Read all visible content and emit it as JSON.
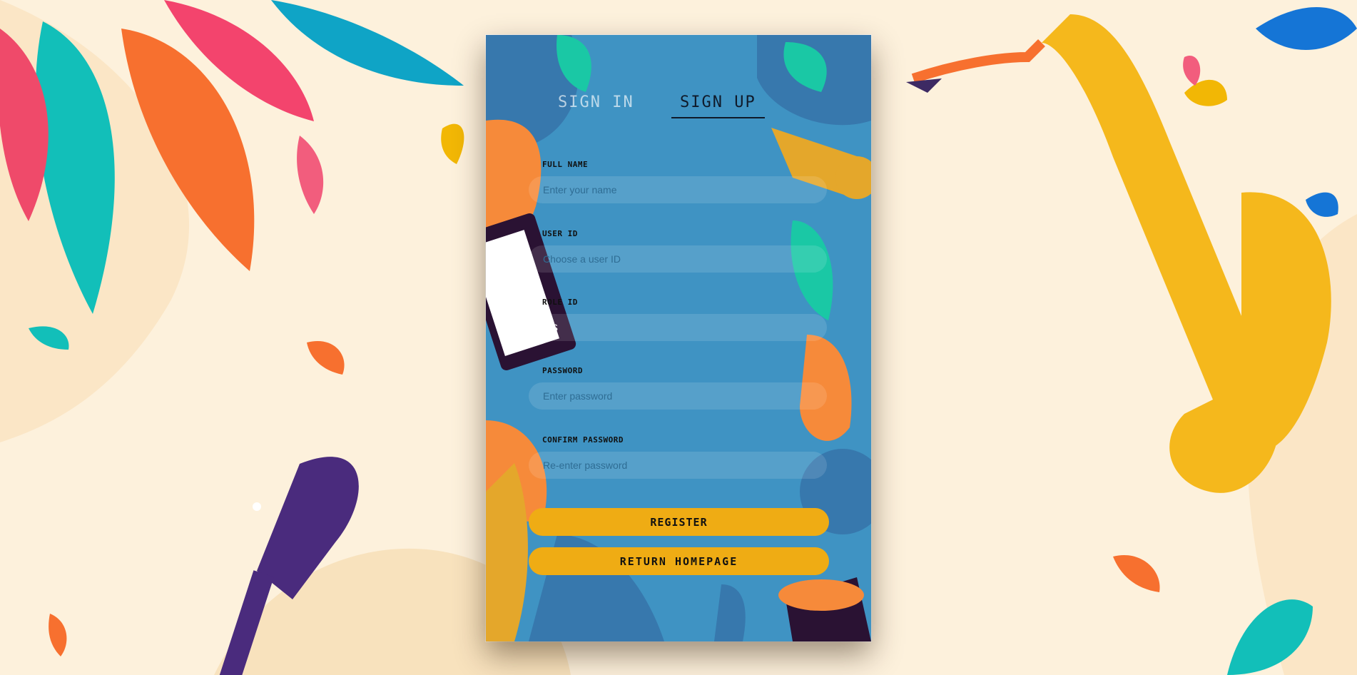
{
  "tabs": {
    "sign_in": "SIGN IN",
    "sign_up": "SIGN UP",
    "active": "sign_up"
  },
  "form": {
    "full_name": {
      "label": "FULL NAME",
      "placeholder": "Enter your name",
      "value": ""
    },
    "user_id": {
      "label": "USER ID",
      "placeholder": "Choose a user ID",
      "value": ""
    },
    "role_id": {
      "label": "ROLE ID",
      "placeholder": "",
      "value": "MS"
    },
    "password": {
      "label": "PASSWORD",
      "placeholder": "Enter password",
      "value": ""
    },
    "confirm_password": {
      "label": "CONFIRM PASSWORD",
      "placeholder": "Re-enter password",
      "value": ""
    }
  },
  "buttons": {
    "register": "REGISTER",
    "return_homepage": "RETURN HOMEPAGE"
  },
  "colors": {
    "card": "#3f93c3",
    "button": "#efac14",
    "background": "#fdf1dc"
  }
}
